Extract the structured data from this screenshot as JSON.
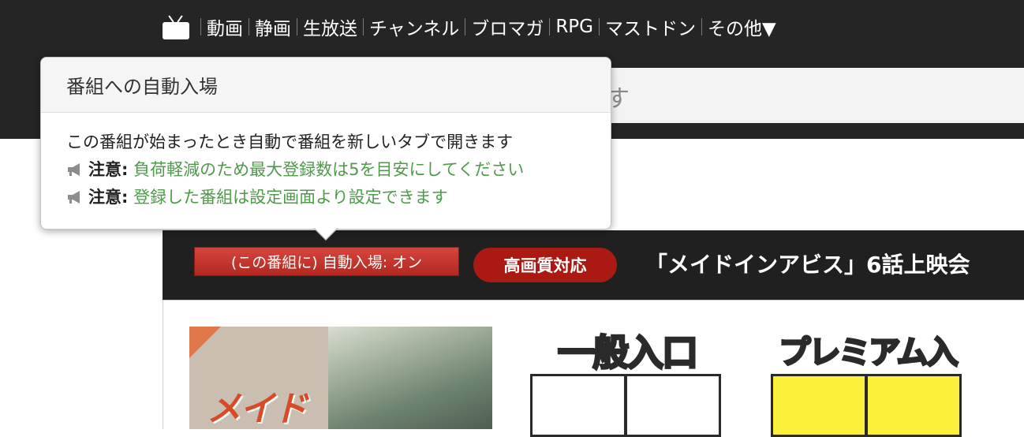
{
  "nav": {
    "logo_icon": "niconico-tv-icon",
    "items": [
      {
        "label": "動画"
      },
      {
        "label": "静画"
      },
      {
        "label": "生放送"
      },
      {
        "label": "チャンネル"
      },
      {
        "label": "ブロマガ"
      },
      {
        "label": "RPG"
      },
      {
        "label": "マストドン"
      },
      {
        "label": "その他▼"
      }
    ]
  },
  "search": {
    "visible_text": "す"
  },
  "popup": {
    "title": "番組への自動入場",
    "description": "この番組が始まったとき自動で番組を新しいタブで開きます",
    "notes": [
      {
        "icon": "megaphone-icon",
        "label": "注意:",
        "text": "負荷軽減のため最大登録数は5を目安にしてください"
      },
      {
        "icon": "megaphone-icon",
        "label": "注意:",
        "text": "登録した番組は設定画面より設定できます"
      }
    ]
  },
  "program": {
    "auto_entry_button": "(この番組に) 自動入場: オン",
    "hq_badge": "高画質対応",
    "title": "「メイドインアビス」6話上映会"
  },
  "thumbnail": {
    "logo_text": "メイドイン"
  },
  "entrances": {
    "general": "一般入口",
    "premium": "プレミアム入口"
  },
  "colors": {
    "topbar": "#252525",
    "auto_button": "#c1352c",
    "hq_badge": "#ab1a12",
    "note_text": "#4f9a4b",
    "premium_door": "#fdf03a"
  }
}
